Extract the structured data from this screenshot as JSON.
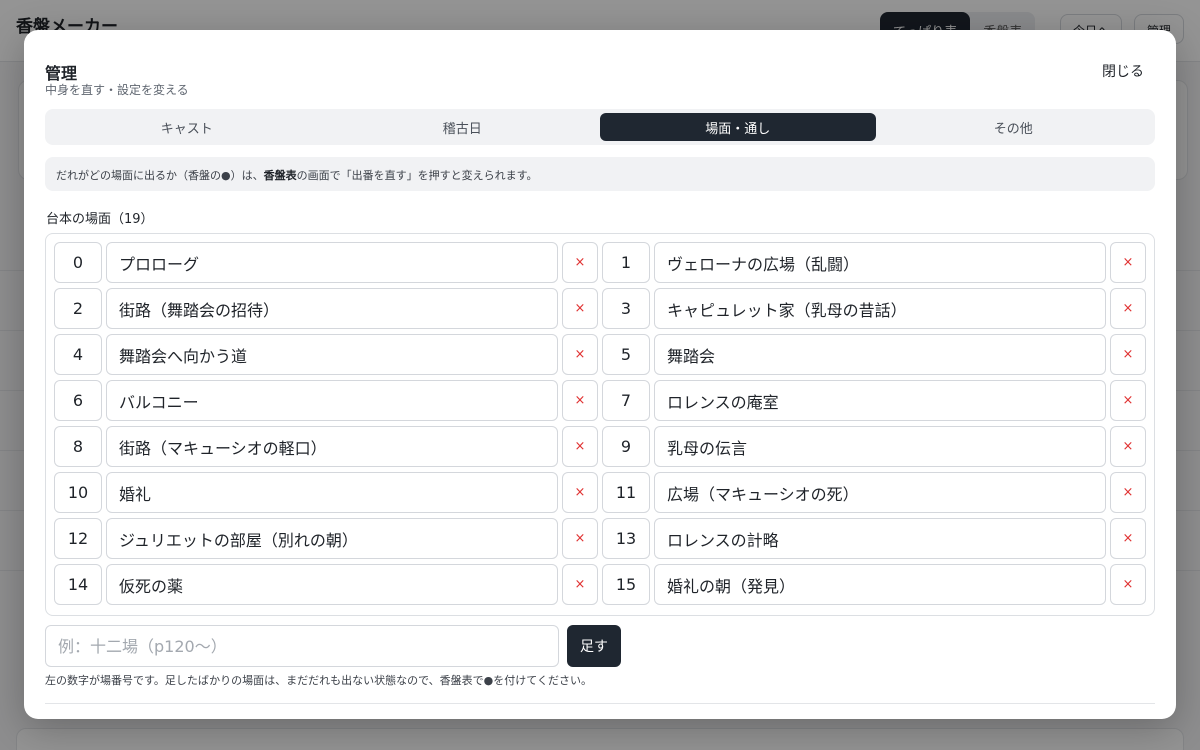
{
  "background": {
    "app_title": "香盤メーカー",
    "view_tabs": [
      "てっぱり表",
      "香盤表"
    ],
    "today_button": "今日へ",
    "manage_button": "管理"
  },
  "modal": {
    "title": "管理",
    "subtitle": "中身を直す・設定を変える",
    "close_label": "閉じる",
    "tabs": [
      {
        "label": "キャスト",
        "active": false
      },
      {
        "label": "稽古日",
        "active": false
      },
      {
        "label": "場面・通し",
        "active": true
      },
      {
        "label": "その他",
        "active": false
      }
    ],
    "notice": {
      "prefix": "だれがどの場面に出るか（香盤の●）は、",
      "bold": "香盤表",
      "suffix": "の画面で「出番を直す」を押すと変えられます。"
    },
    "scenes_heading": "台本の場面（19）",
    "scenes": [
      {
        "number": "0",
        "name": "プロローグ"
      },
      {
        "number": "1",
        "name": "ヴェローナの広場（乱闘）"
      },
      {
        "number": "2",
        "name": "街路（舞踏会の招待）"
      },
      {
        "number": "3",
        "name": "キャピュレット家（乳母の昔話）"
      },
      {
        "number": "4",
        "name": "舞踏会へ向かう道"
      },
      {
        "number": "5",
        "name": "舞踏会"
      },
      {
        "number": "6",
        "name": "バルコニー"
      },
      {
        "number": "7",
        "name": "ロレンスの庵室"
      },
      {
        "number": "8",
        "name": "街路（マキューシオの軽口）"
      },
      {
        "number": "9",
        "name": "乳母の伝言"
      },
      {
        "number": "10",
        "name": "婚礼"
      },
      {
        "number": "11",
        "name": "広場（マキューシオの死）"
      },
      {
        "number": "12",
        "name": "ジュリエットの部屋（別れの朝）"
      },
      {
        "number": "13",
        "name": "ロレンスの計略"
      },
      {
        "number": "14",
        "name": "仮死の薬"
      },
      {
        "number": "15",
        "name": "婚礼の朝（発見）"
      }
    ],
    "delete_label": "×",
    "add_placeholder": "例：十二場（p120〜）",
    "add_label": "足す",
    "help_text": "左の数字が場番号です。足したばかりの場面は、まだだれも出ない状態なので、香盤表で●を付けてください。"
  }
}
